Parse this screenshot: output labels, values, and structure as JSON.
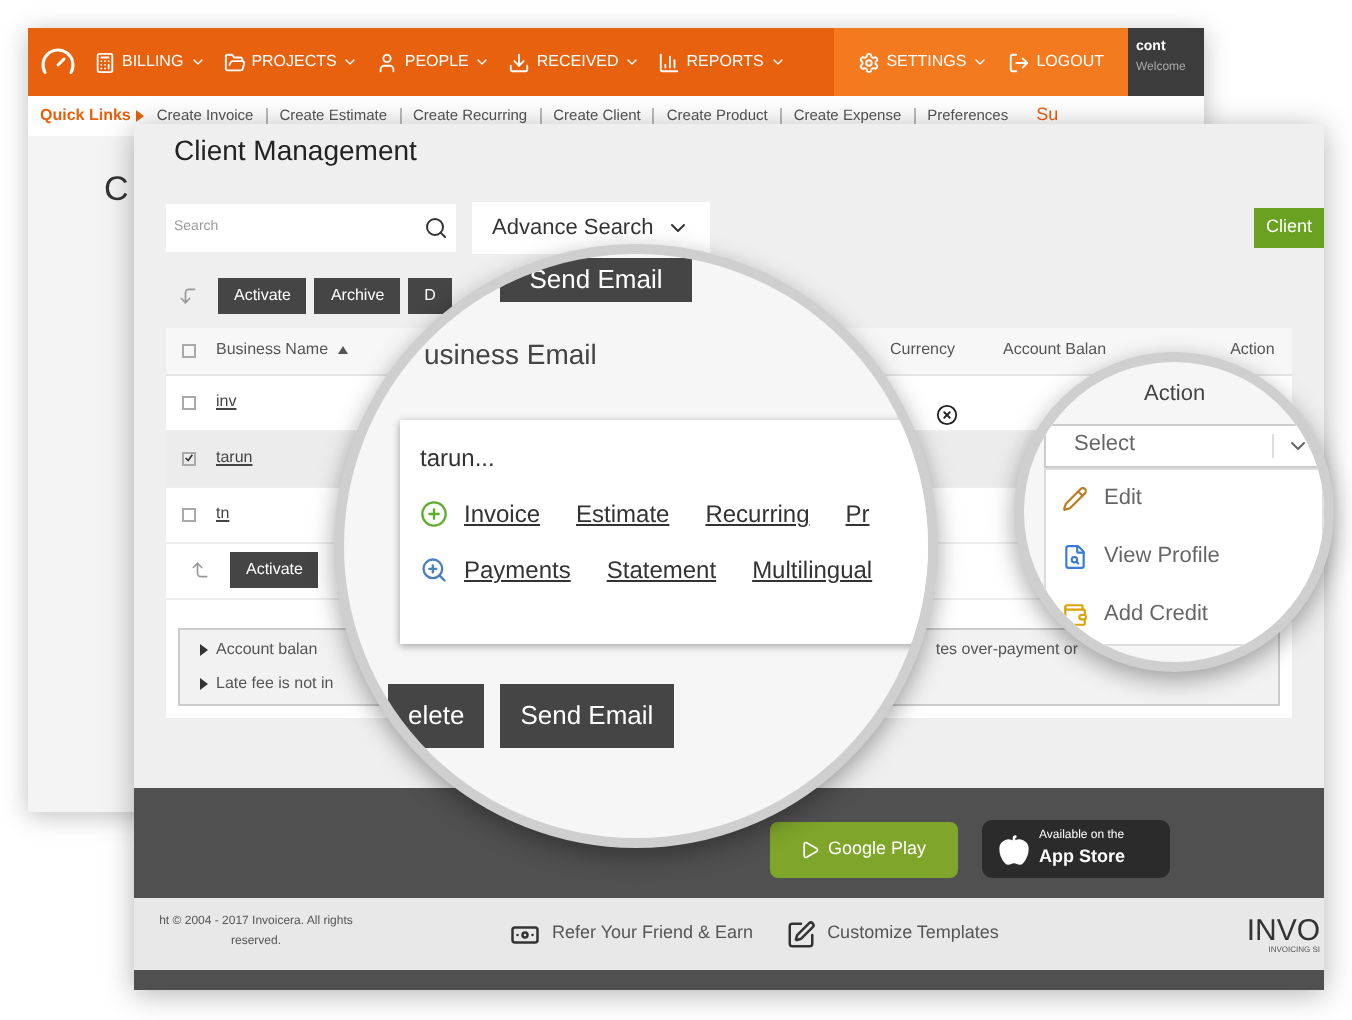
{
  "back_window": {
    "nav": [
      "BILLING",
      "PROJECTS",
      "PEOPLE",
      "RECEIVED",
      "REPORTS"
    ],
    "nav_right": [
      {
        "label": "SETTINGS",
        "kind": "dropdown"
      },
      {
        "label": "LOGOUT",
        "kind": "link"
      }
    ],
    "user": {
      "name": "cont",
      "greeting": "Welcome"
    },
    "quick_links": {
      "label": "Quick Links",
      "items": [
        "Create Invoice",
        "Create Estimate",
        "Create Recurring",
        "Create Client",
        "Create Product",
        "Create Expense",
        "Preferences"
      ],
      "extra": "Su"
    },
    "title_cut": "C"
  },
  "window": {
    "title": "Client Management",
    "search": {
      "placeholder": "Search"
    },
    "advance_search": "Advance Search",
    "client_button": "Client",
    "top_toolbar": [
      "Activate",
      "Archive",
      "D"
    ],
    "select_all_checked": false,
    "columns": [
      {
        "label": "Business Name",
        "sorted": true
      },
      {
        "label": "Currency",
        "sorted": false
      },
      {
        "label": "Account Balan",
        "sorted": false
      },
      {
        "label": "Action",
        "sorted": false
      }
    ],
    "rows": [
      {
        "name": "inv",
        "checked": false
      },
      {
        "name": "tarun",
        "checked": true
      },
      {
        "name": "tn",
        "checked": false
      }
    ],
    "bottom_toolbar": [
      "Activate"
    ],
    "notes": [
      "Account balan",
      "Late fee is not in"
    ],
    "note_tail": "tes over-payment or",
    "footer": {
      "google_play": "Google Play",
      "app_store_top": "Available on the",
      "app_store": "App Store",
      "copyright": "ht © 2004 - 2017 Invoicera. All rights reserved.",
      "links": [
        "Refer Your Friend & Earn",
        "Customize Templates"
      ],
      "logo": "INVO",
      "logo_sub": "INVOICING SI"
    }
  },
  "magnifier_left": {
    "top_button": "Send Email",
    "heading": "usiness Email",
    "popup": {
      "name": "tarun...",
      "rows": [
        [
          "Invoice",
          "Estimate",
          "Recurring",
          "Pr"
        ],
        [
          "Payments",
          "Statement",
          "Multilingual"
        ]
      ]
    },
    "buttons": [
      "elete",
      "Send Email"
    ]
  },
  "magnifier_right": {
    "heading": "Action",
    "select": "Select",
    "menu": [
      "Edit",
      "View Profile",
      "Add Credit"
    ]
  }
}
